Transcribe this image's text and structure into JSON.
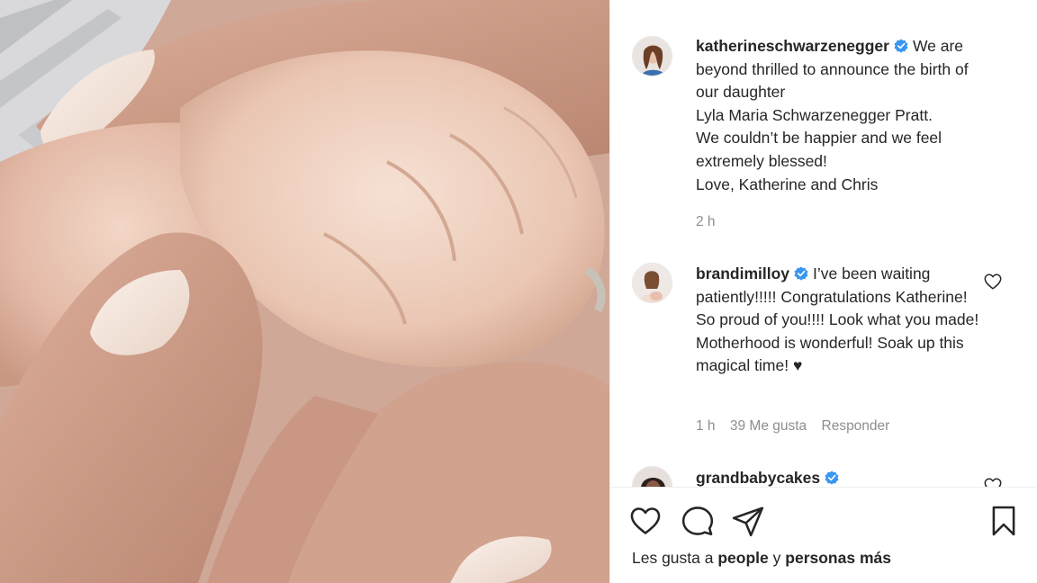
{
  "post": {
    "photo_alt": "baby-hand-photo",
    "caption": {
      "username": "katherineschwarzenegger",
      "verified": true,
      "text": "We are\nbeyond thrilled to announce the birth of our daughter\nLyla Maria Schwarzenegger Pratt.\nWe couldn’t be happier and we feel extremely blessed!\nLove, Katherine and Chris",
      "time": "2 h"
    },
    "comments": [
      {
        "username": "brandimilloy",
        "verified": true,
        "text": "I’ve been waiting patiently!!!!! Congratulations Katherine! So proud of you!!!! Look what you made! Motherhood is wonderful! Soak up this magical time! ♥",
        "time": "1 h",
        "likes": "39 Me gusta",
        "reply": "Responder"
      },
      {
        "username": "grandbabycakes",
        "verified": true
      }
    ],
    "likes_summary": {
      "prefix": "Les gusta a",
      "user": "people",
      "joiner": "y",
      "others": "personas más"
    }
  },
  "colors": {
    "text": "#262626",
    "muted": "#8e8e8e",
    "verified": "#3897f0",
    "border": "#efefef"
  }
}
